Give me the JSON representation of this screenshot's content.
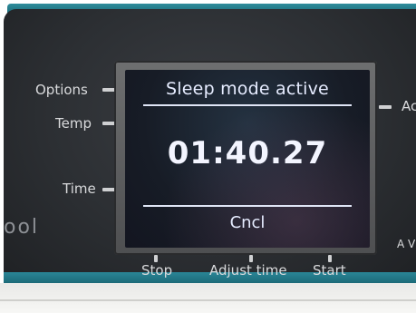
{
  "display": {
    "status": "Sleep mode active",
    "timer": "01:40.27",
    "cancel_label": "Cncl"
  },
  "left_buttons": {
    "options": "Options",
    "temp": "Temp",
    "time": "Time"
  },
  "bottom_buttons": {
    "stop": "Stop",
    "adjust_time": "Adjust time",
    "start": "Start"
  },
  "right_edge": {
    "label_top": "Ac",
    "label_bottom": "A V"
  },
  "brand": {
    "text": "ool"
  }
}
